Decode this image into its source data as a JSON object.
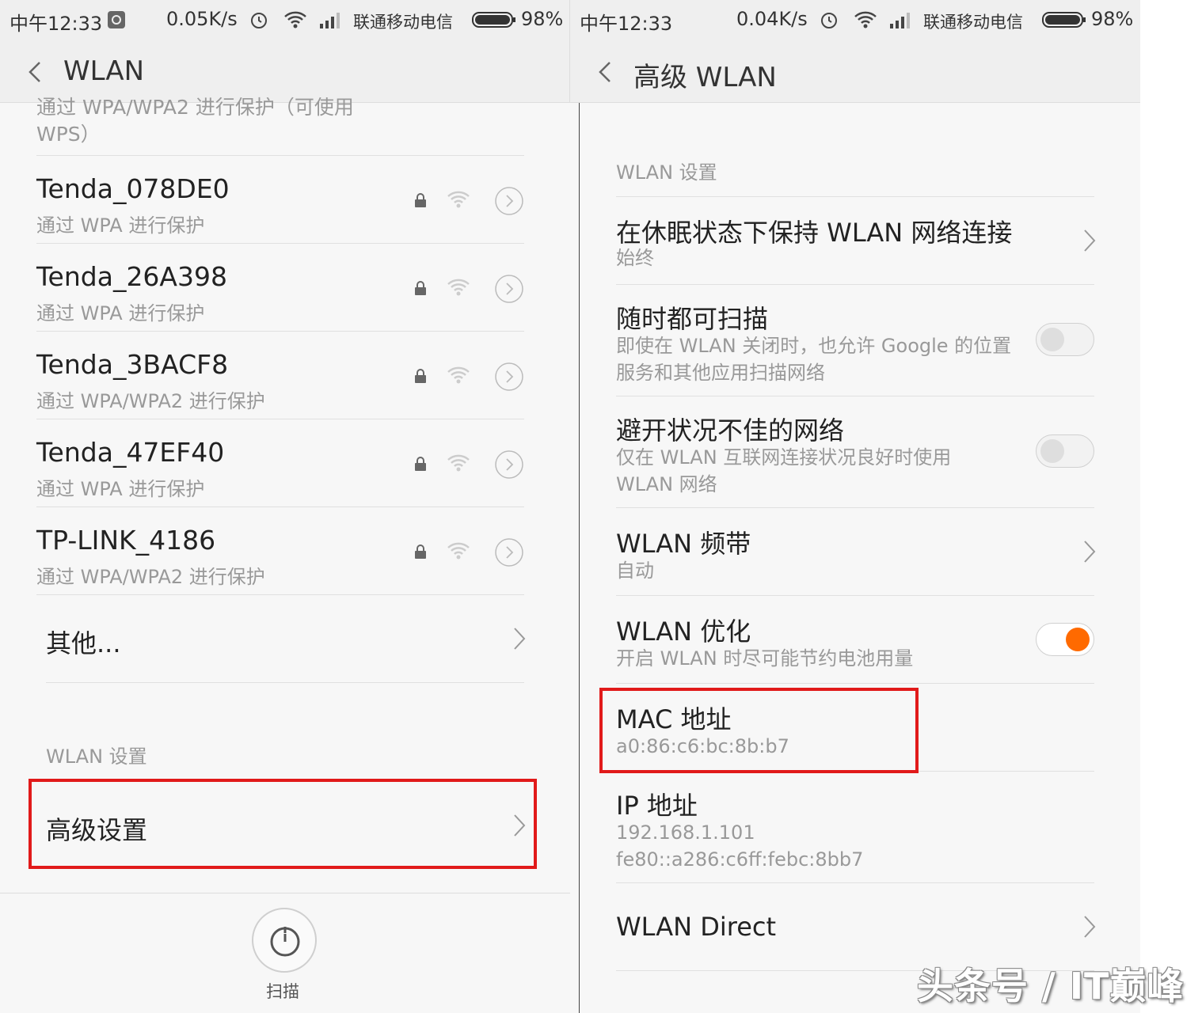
{
  "left": {
    "status": {
      "time": "中午12:33",
      "speed": "0.05K/s",
      "carrier": "联通移动电信",
      "battery": "98%"
    },
    "title": "WLAN",
    "partial_row": {
      "sub_line1": "通过 WPA/WPA2 进行保护（可使用",
      "sub_line2": "WPS）"
    },
    "networks": [
      {
        "name": "Tenda_078DE0",
        "security": "通过 WPA 进行保护"
      },
      {
        "name": "Tenda_26A398",
        "security": "通过 WPA 进行保护"
      },
      {
        "name": "Tenda_3BACF8",
        "security": "通过 WPA/WPA2 进行保护"
      },
      {
        "name": "Tenda_47EF40",
        "security": "通过 WPA 进行保护"
      },
      {
        "name": "TP-LINK_4186",
        "security": "通过 WPA/WPA2 进行保护"
      }
    ],
    "other": "其他...",
    "section_header": "WLAN 设置",
    "advanced": "高级设置",
    "scan_label": "扫描"
  },
  "right": {
    "status": {
      "time": "中午12:33",
      "speed": "0.04K/s",
      "carrier": "联通移动电信",
      "battery": "98%"
    },
    "title": "高级 WLAN",
    "section_header": "WLAN 设置",
    "items": [
      {
        "title": "在休眠状态下保持 WLAN 网络连接",
        "sub": "始终"
      },
      {
        "title": "随时都可扫描",
        "sub": "即使在 WLAN 关闭时，也允许 Google 的位置服务和其他应用扫描网络",
        "toggle": false
      },
      {
        "title": "避开状况不佳的网络",
        "sub": "仅在 WLAN 互联网连接状况良好时使用 WLAN 网络",
        "toggle": false
      },
      {
        "title": "WLAN 频带",
        "sub": "自动"
      },
      {
        "title": "WLAN 优化",
        "sub": "开启 WLAN 时尽可能节约电池用量",
        "toggle": true
      },
      {
        "title": "MAC 地址",
        "sub": "a0:86:c6:bc:8b:b7"
      },
      {
        "title": "IP 地址",
        "sub": "192.168.1.101",
        "sub2": "fe80::a286:c6ff:febc:8bb7"
      },
      {
        "title": "WLAN Direct"
      }
    ]
  },
  "watermark": "头条号 / IT巅峰",
  "colors": {
    "highlight": "#e11a1a",
    "toggle_on": "#ff6a00"
  }
}
